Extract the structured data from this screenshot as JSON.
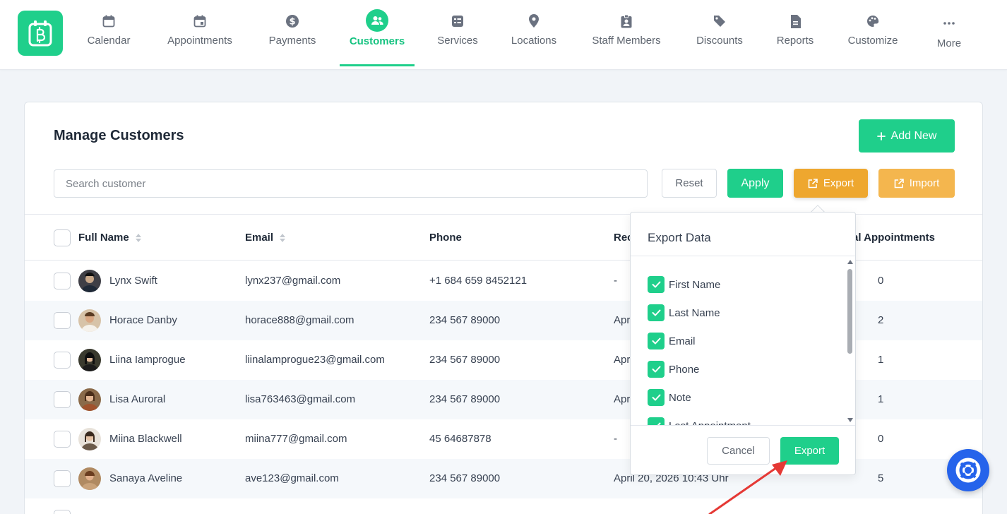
{
  "nav": {
    "items": [
      {
        "label": "Calendar",
        "icon": "calendar-icon"
      },
      {
        "label": "Appointments",
        "icon": "calendar-check-icon"
      },
      {
        "label": "Payments",
        "icon": "dollar-icon"
      },
      {
        "label": "Customers",
        "icon": "users-icon",
        "active": true
      },
      {
        "label": "Services",
        "icon": "list-icon"
      },
      {
        "label": "Locations",
        "icon": "location-pin-icon"
      },
      {
        "label": "Staff Members",
        "icon": "id-badge-icon"
      },
      {
        "label": "Discounts",
        "icon": "tag-icon"
      },
      {
        "label": "Reports",
        "icon": "file-icon"
      },
      {
        "label": "Customize",
        "icon": "palette-icon"
      },
      {
        "label": "More",
        "icon": "ellipsis-icon"
      }
    ]
  },
  "page": {
    "title": "Manage Customers",
    "add_new_label": "Add New",
    "search_placeholder": "Search customer",
    "reset_label": "Reset",
    "apply_label": "Apply",
    "export_label": "Export",
    "import_label": "Import"
  },
  "table": {
    "columns": {
      "full_name": "Full Name",
      "email": "Email",
      "phone": "Phone",
      "registered": "Rec",
      "total_appointments": "al Appointments"
    },
    "rows": [
      {
        "name": "Lynx Swift",
        "email": "lynx237@gmail.com",
        "phone": "+1 684 659 8452121",
        "registered": "-",
        "appointments": "0"
      },
      {
        "name": "Horace Danby",
        "email": "horace888@gmail.com",
        "phone": "234 567 89000",
        "registered": "Apr",
        "appointments": "2"
      },
      {
        "name": "Liina Iamprogue",
        "email": "liinalamprogue23@gmail.com",
        "phone": "234 567 89000",
        "registered": "Apr",
        "appointments": "1"
      },
      {
        "name": "Lisa Auroral",
        "email": "lisa763463@gmail.com",
        "phone": "234 567 89000",
        "registered": "Apr",
        "appointments": "1"
      },
      {
        "name": "Miina Blackwell",
        "email": "miina777@gmail.com",
        "phone": "45 64687878",
        "registered": "-",
        "appointments": "0"
      },
      {
        "name": "Sanaya Aveline",
        "email": "ave123@gmail.com",
        "phone": "234 567 89000",
        "registered": "April 20, 2026 10:43 Uhr",
        "appointments": "5"
      }
    ]
  },
  "export_popover": {
    "title": "Export Data",
    "fields": [
      "First Name",
      "Last Name",
      "Email",
      "Phone",
      "Note",
      "Last Appointment"
    ],
    "cancel_label": "Cancel",
    "export_label": "Export"
  },
  "colors": {
    "accent": "#1fcf8b",
    "export": "#eea72f",
    "import": "#f4b64e",
    "help": "#2563eb",
    "annotation_arrow": "#e53935"
  }
}
